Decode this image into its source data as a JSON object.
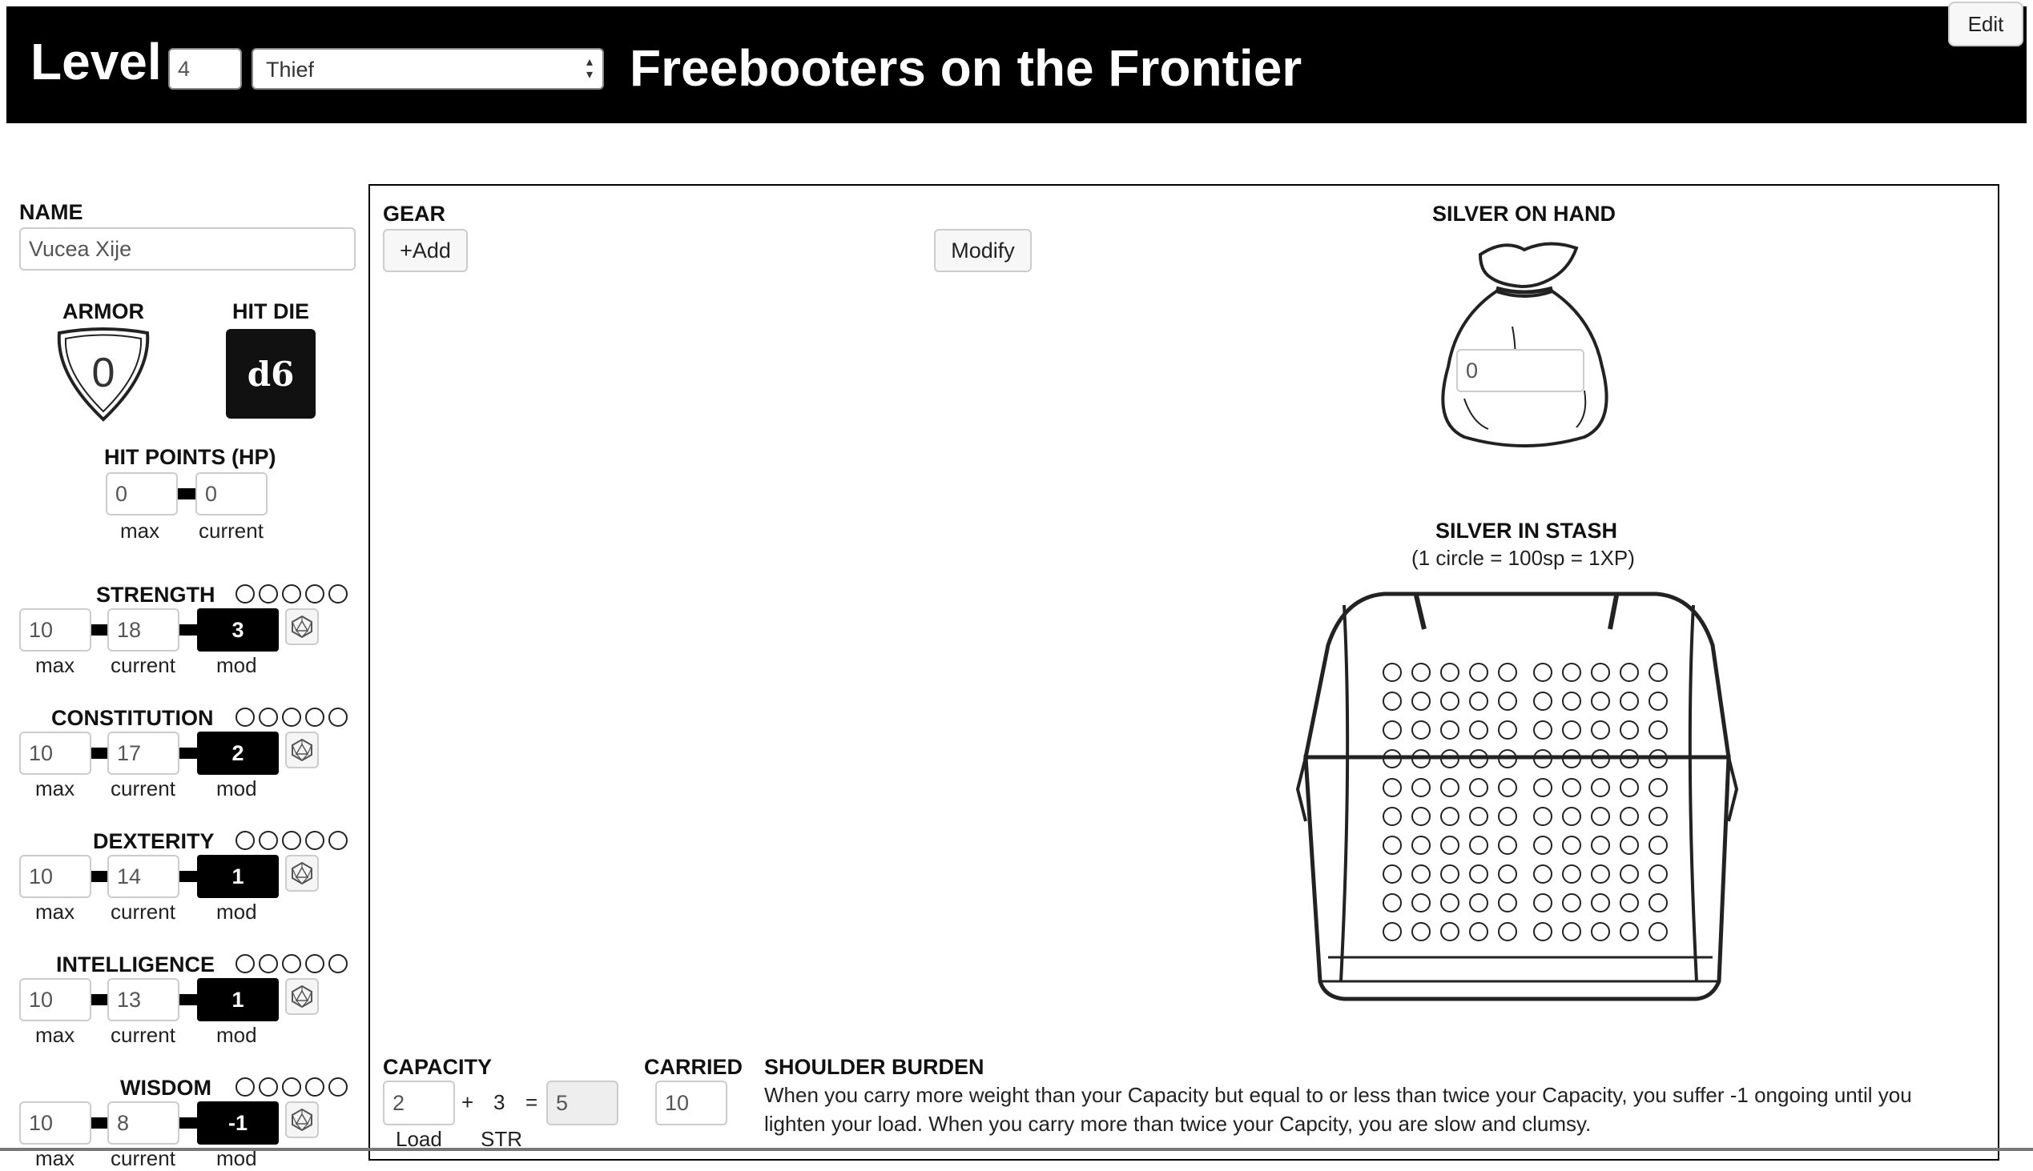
{
  "header": {
    "level_label": "Level",
    "level_value": "4",
    "class_value": "Thief",
    "title": "Freebooters on the Frontier",
    "edit_label": "Edit"
  },
  "character": {
    "name_label": "NAME",
    "name_value": "Vucea Xije",
    "armor_label": "ARMOR",
    "armor_value": "0",
    "hitdie_label": "HIT DIE",
    "hitdie_value": "d6",
    "hp_label": "HIT POINTS (HP)",
    "hp_max": "0",
    "hp_current": "0",
    "max_label": "max",
    "current_label": "current",
    "mod_label": "mod"
  },
  "abilities": [
    {
      "name": "STRENGTH",
      "max": "10",
      "current": "18",
      "mod": "3"
    },
    {
      "name": "CONSTITUTION",
      "max": "10",
      "current": "17",
      "mod": "2"
    },
    {
      "name": "DEXTERITY",
      "max": "10",
      "current": "14",
      "mod": "1"
    },
    {
      "name": "INTELLIGENCE",
      "max": "10",
      "current": "13",
      "mod": "1"
    },
    {
      "name": "WISDOM",
      "max": "10",
      "current": "8",
      "mod": "-1"
    }
  ],
  "gear": {
    "label": "GEAR",
    "add_label": "+Add",
    "modify_label": "Modify"
  },
  "silver": {
    "on_hand_label": "SILVER ON HAND",
    "on_hand_value": "0",
    "stash_label": "SILVER IN STASH",
    "stash_note": "(1 circle = 100sp = 1XP)"
  },
  "capacity": {
    "label": "CAPACITY",
    "load_value": "2",
    "plus": "+",
    "str_value": "3",
    "equals": "=",
    "total_value": "5",
    "load_label": "Load",
    "str_label": "STR",
    "carried_label": "CARRIED",
    "carried_value": "10",
    "burden_label": "SHOULDER BURDEN",
    "burden_text": "When you carry more weight than your Capacity but equal to or less than twice your Capacity, you suffer -1 ongoing until you lighten your load. When you carry more than twice your Capcity, you are slow and clumsy."
  }
}
